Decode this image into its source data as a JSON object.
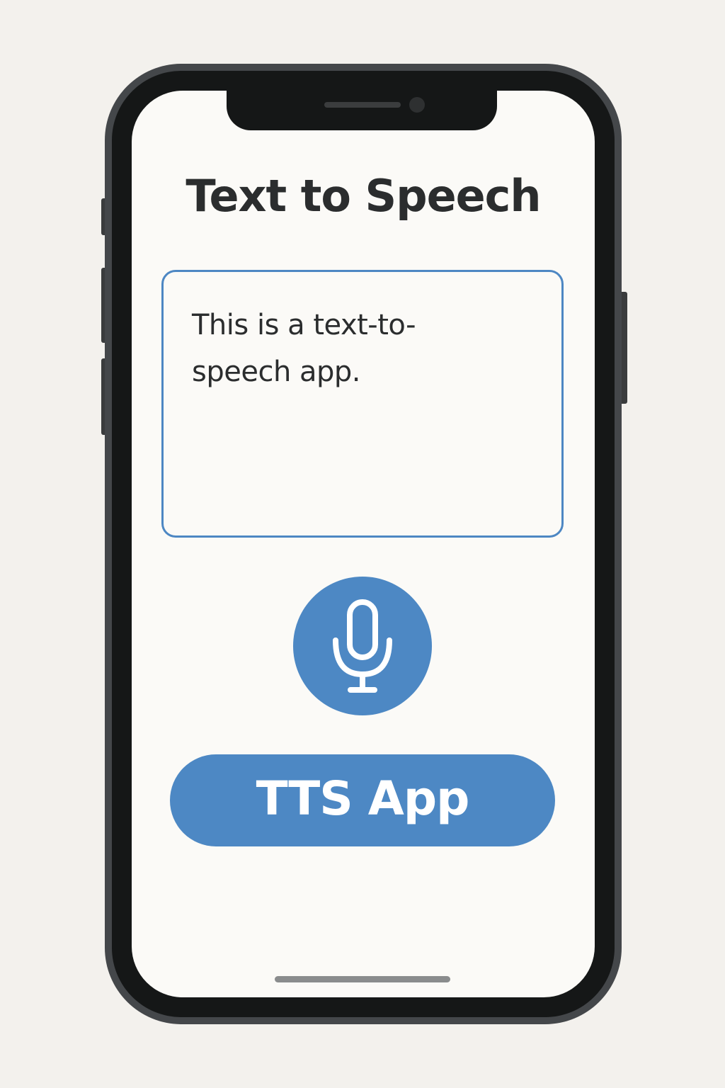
{
  "app": {
    "title": "Text to Speech",
    "text_input_value": "This is a text-to-speech app.",
    "primary_button_label": "TTS App"
  },
  "icons": {
    "mic": "microphone-icon"
  },
  "colors": {
    "accent": "#4d88c4",
    "text": "#2b2d2e",
    "screen_bg": "#fbfaf7",
    "phone_frame": "#44474a",
    "page_bg": "#f3f1ed"
  }
}
